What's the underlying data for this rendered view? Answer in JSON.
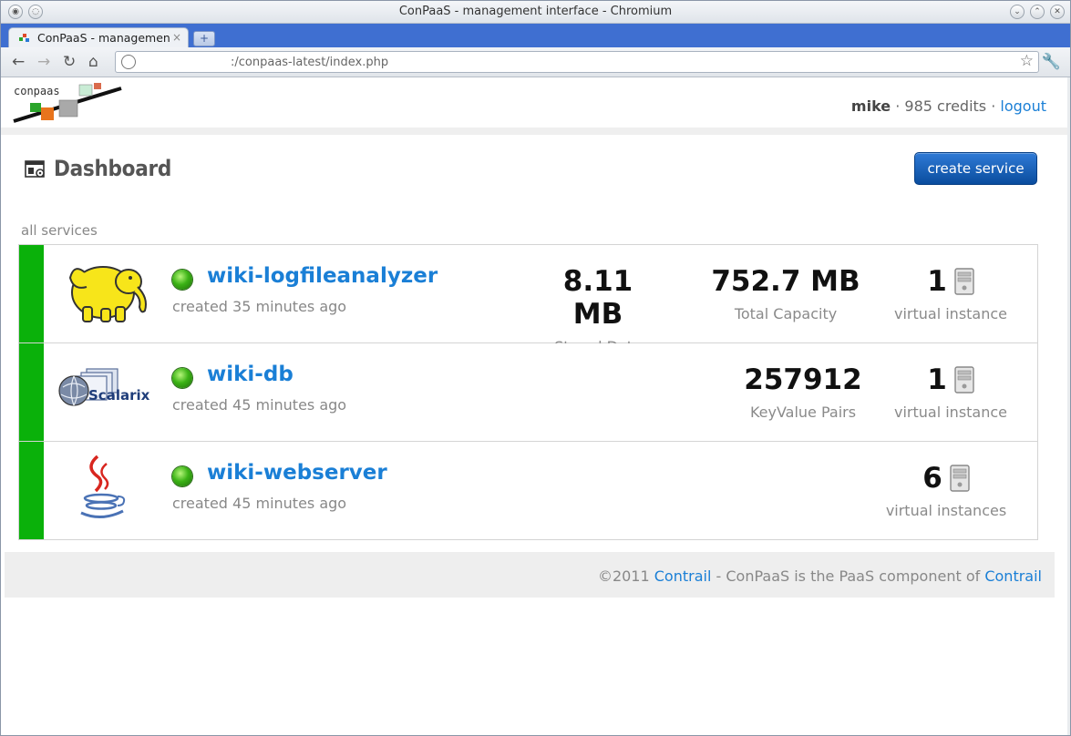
{
  "window": {
    "title": "ConPaaS - management interface - Chromium"
  },
  "tab": {
    "title": "ConPaaS - managemen",
    "close": "×",
    "new": "+"
  },
  "toolbar": {
    "url": ":/conpaas-latest/index.php"
  },
  "header": {
    "logo_text": "conpaas",
    "username": "mike",
    "separator": "·",
    "credits": "985 credits",
    "logout": "logout"
  },
  "dashboard": {
    "title": "Dashboard",
    "create_button": "create service",
    "section_label": "all services"
  },
  "services": [
    {
      "name": "wiki-logfileanalyzer",
      "created": "created 35 minutes ago",
      "logo": "hadoop-elephant-logo",
      "stats": [
        {
          "value": "8.11 MB",
          "label": "Stored Data"
        },
        {
          "value": "752.7 MB",
          "label": "Total Capacity"
        }
      ],
      "instances": {
        "count": "1",
        "label": "virtual instance"
      }
    },
    {
      "name": "wiki-db",
      "created": "created 45 minutes ago",
      "logo": "scalarix-logo",
      "logo_text": "Scalarix",
      "stats": [
        {
          "value": "257912",
          "label": "KeyValue Pairs"
        }
      ],
      "instances": {
        "count": "1",
        "label": "virtual instance"
      }
    },
    {
      "name": "wiki-webserver",
      "created": "created 45 minutes ago",
      "logo": "java-logo",
      "stats": [],
      "instances": {
        "count": "6",
        "label": "virtual instances"
      }
    }
  ],
  "footer": {
    "copyright": "©2011",
    "link1": "Contrail",
    "middle": " - ConPaaS is the PaaS component of ",
    "link2": "Contrail"
  },
  "colors": {
    "status_green": "#0ab10a",
    "link_blue": "#1a7fd6",
    "button_blue": "#0a4d9e"
  }
}
